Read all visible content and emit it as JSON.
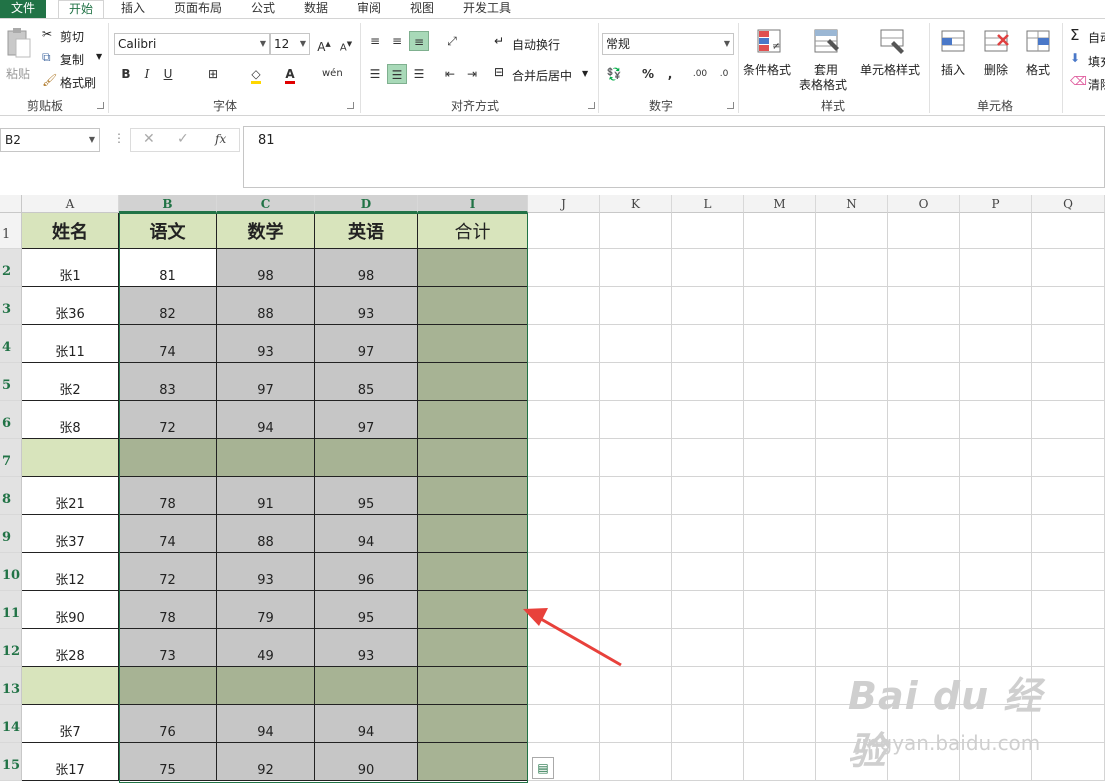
{
  "tabs": [
    "文件",
    "开始",
    "插入",
    "页面布局",
    "公式",
    "数据",
    "审阅",
    "视图",
    "开发工具"
  ],
  "ribbon": {
    "clipboard": {
      "paste": "粘贴",
      "cut": "剪切",
      "copy": "复制",
      "format_painter": "格式刷",
      "label": "剪贴板"
    },
    "font": {
      "name": "Calibri",
      "size": "12",
      "label": "字体"
    },
    "align": {
      "wrap": "自动换行",
      "merge": "合并后居中",
      "label": "对齐方式"
    },
    "number": {
      "format": "常规",
      "label": "数字"
    },
    "styles": {
      "conditional": "条件格式",
      "table_fmt_1": "套用",
      "table_fmt_2": "表格格式",
      "cell_styles": "单元格样式",
      "label": "样式"
    },
    "cells": {
      "insert": "插入",
      "delete": "删除",
      "format": "格式",
      "label": "单元格"
    },
    "edit": {
      "autosum": "自动",
      "fill": "填充",
      "clear": "清除"
    }
  },
  "formula_bar": {
    "name_box": "B2",
    "value": "81"
  },
  "columns": [
    "A",
    "B",
    "C",
    "D",
    "I",
    "J",
    "K",
    "L",
    "M",
    "N",
    "O",
    "P",
    "Q"
  ],
  "selected_columns": [
    "B",
    "C",
    "D",
    "I"
  ],
  "header_row": [
    "姓名",
    "语文",
    "数学",
    "英语",
    "合计"
  ],
  "rows": [
    {
      "num": "2",
      "name": "张1",
      "b": "81",
      "c": "98",
      "d": "98"
    },
    {
      "num": "3",
      "name": "张36",
      "b": "82",
      "c": "88",
      "d": "93"
    },
    {
      "num": "4",
      "name": "张11",
      "b": "74",
      "c": "93",
      "d": "97"
    },
    {
      "num": "5",
      "name": "张2",
      "b": "83",
      "c": "97",
      "d": "85"
    },
    {
      "num": "6",
      "name": "张8",
      "b": "72",
      "c": "94",
      "d": "97"
    },
    {
      "num": "7",
      "name": "",
      "b": "",
      "c": "",
      "d": "",
      "blank": true
    },
    {
      "num": "8",
      "name": "张21",
      "b": "78",
      "c": "91",
      "d": "95"
    },
    {
      "num": "9",
      "name": "张37",
      "b": "74",
      "c": "88",
      "d": "94"
    },
    {
      "num": "10",
      "name": "张12",
      "b": "72",
      "c": "93",
      "d": "96"
    },
    {
      "num": "11",
      "name": "张90",
      "b": "78",
      "c": "79",
      "d": "95"
    },
    {
      "num": "12",
      "name": "张28",
      "b": "73",
      "c": "49",
      "d": "93"
    },
    {
      "num": "13",
      "name": "",
      "b": "",
      "c": "",
      "d": "",
      "blank": true
    },
    {
      "num": "14",
      "name": "张7",
      "b": "76",
      "c": "94",
      "d": "94"
    },
    {
      "num": "15",
      "name": "张17",
      "b": "75",
      "c": "92",
      "d": "90"
    }
  ],
  "colors": {
    "header_green": "#d8e4bc",
    "selection_gray": "#c6c6c6",
    "selection_olive": "#a7b394",
    "accent": "#217346",
    "arrow": "#e8413b"
  },
  "watermark": {
    "brand": "Bai du 经验",
    "url": "jingyan.baidu.com"
  }
}
